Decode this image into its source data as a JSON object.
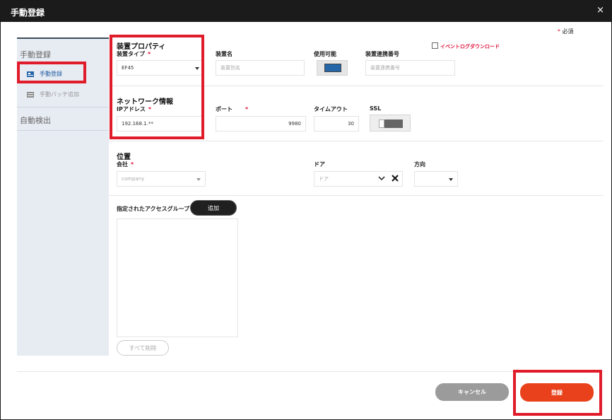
{
  "window": {
    "title": "手動登録",
    "close_glyph": "×"
  },
  "required_note": {
    "mark": "*",
    "text": "必須"
  },
  "event_log": {
    "label": "イベントログダウンロード",
    "checked": false
  },
  "sidebar": {
    "section1": "手動登録",
    "items": [
      {
        "label": "手動登録",
        "icon": "card-icon",
        "active": true
      },
      {
        "label": "手動バッチ追加",
        "icon": "batch-icon",
        "active": false
      }
    ],
    "section2": "自動検出"
  },
  "device_props": {
    "title": "装置プロパティ",
    "type_label": "装置タイプ",
    "type_value": "EF45",
    "name_label": "装置名",
    "name_placeholder": "装置別名",
    "enabled_label": "使用可能",
    "link_label": "装置連携番号",
    "link_placeholder": "装置連携番号"
  },
  "network": {
    "title": "ネットワーク情報",
    "ip_label": "IPアドレス",
    "ip_value": "192.168.1.**",
    "port_label": "ポート",
    "port_value": "9980",
    "timeout_label": "タイムアウト",
    "timeout_value": "30",
    "ssl_label": "SSL"
  },
  "location": {
    "title": "位置",
    "company_label": "会社",
    "company_placeholder": "company",
    "door_label": "ドア",
    "door_placeholder": "ドア",
    "direction_label": "方向",
    "direction_value": ""
  },
  "access_group": {
    "title": "指定されたアクセスグループ",
    "add_label": "追加",
    "delete_all_label": "すべて削除"
  },
  "buttons": {
    "cancel": "キャンセル",
    "register": "登録"
  },
  "colors": {
    "accent": "#e8411b",
    "highlight": "#e01b2a",
    "toggle_on": "#2566a8"
  }
}
